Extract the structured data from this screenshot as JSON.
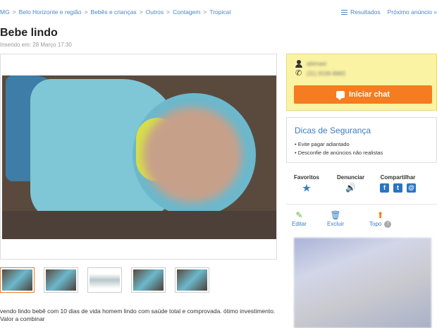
{
  "breadcrumb": {
    "items": [
      "MG",
      "Belo Horizonte e região",
      "Bebês e crianças",
      "Outros",
      "Contagem",
      "Tropical"
    ],
    "separator": ">"
  },
  "topnav": {
    "results_label": "Resultados",
    "next_label": "Próximo anúncio »"
  },
  "listing": {
    "title": "Bebe lindo",
    "inserted": "Inserido em: 28 Março 17:30",
    "description_line1": "vendo lindo bebê com 10 dias de vida homem lindo com saúde total e comprovada. ótimo investimento.",
    "description_line2": "Valor a combinar"
  },
  "gallery": {
    "thumb_count": 5,
    "active_index": 0
  },
  "seller": {
    "name_blurred": "abimaei",
    "phone_blurred": "(31) 9169-8883",
    "chat_label": "Iniciar chat"
  },
  "safety": {
    "title": "Dicas de Segurança",
    "tips": [
      "Evite pagar adiantado",
      "Desconfie de anúncios não realistas"
    ]
  },
  "actions": {
    "favorites_label": "Favoritos",
    "report_label": "Denunciar",
    "share_label": "Compartilhar",
    "share_icons": [
      "f",
      "t",
      "@"
    ]
  },
  "tools": {
    "edit_label": "Editar",
    "delete_label": "Excluir",
    "top_label": "Topo",
    "help_symbol": "!"
  },
  "icons": {
    "star": "★",
    "speaker": "🔊",
    "pencil": "✎",
    "trash": "🗑",
    "up": "⬆",
    "phone": "✆"
  },
  "colors": {
    "link": "#4a86c8",
    "accent_orange": "#f57c20",
    "seller_bg": "#faf3a3",
    "safety_title": "#3a7ec0"
  }
}
